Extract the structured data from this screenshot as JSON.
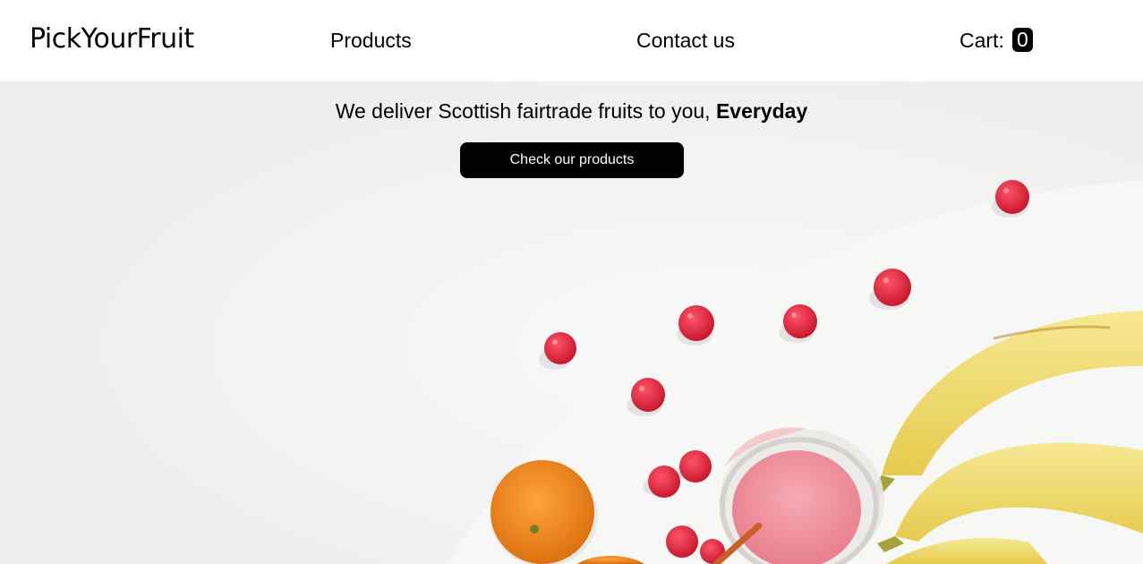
{
  "header": {
    "brand": "PickYourFruit",
    "nav": {
      "products": "Products",
      "contact": "Contact us"
    },
    "cart": {
      "label": "Cart:",
      "count": "0"
    }
  },
  "hero": {
    "tagline_prefix": "We deliver Scottish fairtrade fruits to you, ",
    "tagline_emphasis": "Everyday",
    "cta_label": "Check our products",
    "background_color": "#f1f1f0",
    "image_subject": [
      "raspberry-icon",
      "banana-icon",
      "orange-icon",
      "smoothie-jar-icon"
    ]
  },
  "colors": {
    "primary": "#000000",
    "on_primary": "#ffffff",
    "raspberry": "#d8233a",
    "banana": "#f2df7a",
    "orange": "#f08a1c",
    "smoothie": "#f0909a"
  }
}
